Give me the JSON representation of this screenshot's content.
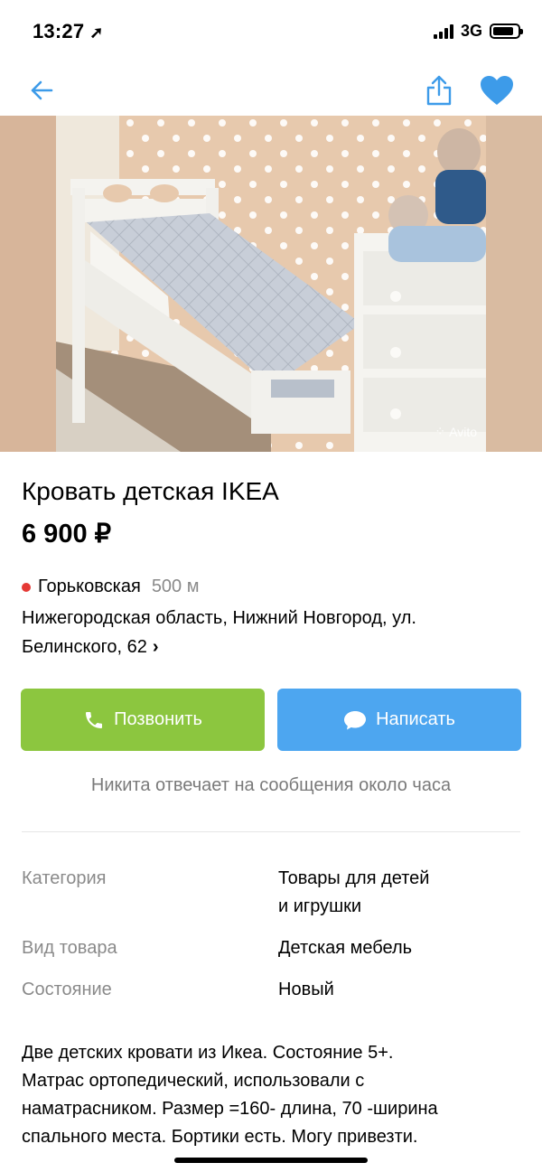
{
  "status_bar": {
    "time": "13:27",
    "network": "3G"
  },
  "nav": {
    "back_icon": "arrow-left-icon",
    "share_icon": "share-icon",
    "favorite_icon": "heart-icon",
    "accent_color": "#3d9be9"
  },
  "photo": {
    "watermark": "Avito"
  },
  "listing": {
    "title": "Кровать детская IKEA",
    "price": "6 900 ₽"
  },
  "location": {
    "metro": "Горьковская",
    "metro_distance": "500 м",
    "metro_color": "#e53935",
    "address_line1": "Нижегородская область, Нижний Новгород, ул.",
    "address_line2": "Белинского, 62"
  },
  "actions": {
    "call_label": "Позвонить",
    "call_color": "#8cc63f",
    "message_label": "Написать",
    "message_color": "#4da6f0"
  },
  "seller_note": "Никита отвечает на сообщения около часа",
  "params": [
    {
      "key": "Категория",
      "value_line1": "Товары для детей",
      "value_line2": "и игрушки"
    },
    {
      "key": "Вид товара",
      "value_line1": "Детская мебель"
    },
    {
      "key": "Состояние",
      "value_line1": "Новый"
    }
  ],
  "description": [
    "Две детских кровати из Икеа. Состояние 5+.",
    "Матрас ортопедический, использовали с",
    "наматрасником. Размер =160- длина, 70 -ширина",
    "спального места. Бортики есть.  Могу привезти."
  ]
}
